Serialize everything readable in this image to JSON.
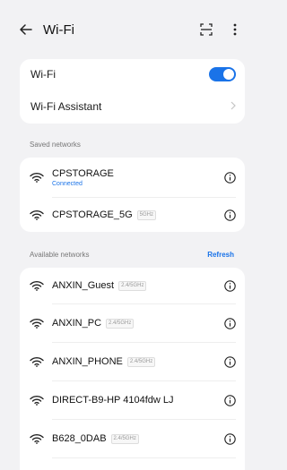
{
  "header": {
    "title": "Wi-Fi",
    "back_icon": "arrow-left-icon",
    "scan_icon": "scan-icon",
    "more_icon": "more-vertical-icon"
  },
  "top_card": {
    "wifi_label": "Wi-Fi",
    "wifi_enabled": true,
    "assistant_label": "Wi-Fi Assistant"
  },
  "saved": {
    "section_label": "Saved networks",
    "networks": [
      {
        "name": "CPSTORAGE",
        "status": "Connected",
        "band": ""
      },
      {
        "name": "CPSTORAGE_5G",
        "status": "",
        "band": "5GHz"
      }
    ]
  },
  "available": {
    "section_label": "Available networks",
    "refresh_label": "Refresh",
    "networks": [
      {
        "name": "ANXIN_Guest",
        "band": "2.4/5GHz"
      },
      {
        "name": "ANXIN_PC",
        "band": "2.4/5GHz"
      },
      {
        "name": "ANXIN_PHONE",
        "band": "2.4/5GHz"
      },
      {
        "name": "DIRECT-B9-HP 4104fdw LJ",
        "band": ""
      },
      {
        "name": "B628_0DAB",
        "band": "2.4/5GHz"
      }
    ]
  },
  "colors": {
    "accent": "#1a73e8",
    "background": "#f2f2f4",
    "card": "#ffffff"
  }
}
